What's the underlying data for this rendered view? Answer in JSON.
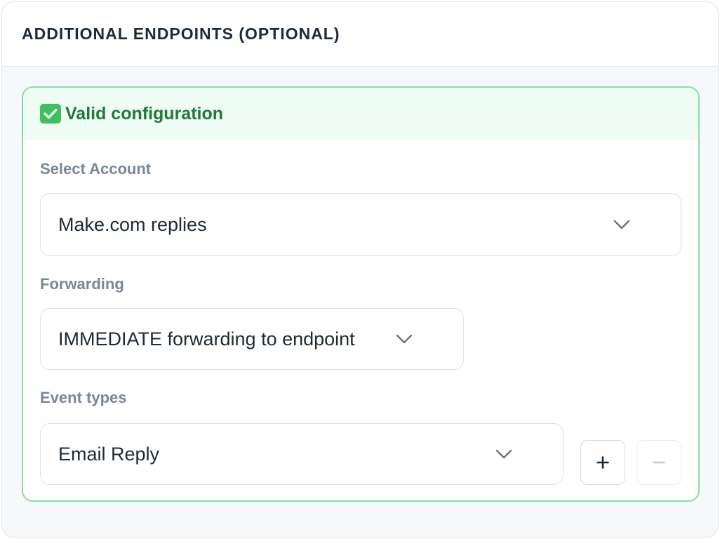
{
  "section": {
    "title": "ADDITIONAL ENDPOINTS (OPTIONAL)"
  },
  "endpoint": {
    "status": {
      "text": "Valid configuration",
      "icon": "check-icon",
      "color": "#1f7a3a"
    },
    "account": {
      "label": "Select Account",
      "value": "Make.com replies"
    },
    "forwarding": {
      "label": "Forwarding",
      "value": "IMMEDIATE forwarding to endpoint"
    },
    "event_types": {
      "label": "Event types",
      "value": "Email Reply"
    },
    "actions": {
      "add_label": "+",
      "remove_label": "−"
    }
  },
  "colors": {
    "success_border": "#86e0a6",
    "success_bg": "#effcf3",
    "label": "#7b8794",
    "text": "#1f2a37"
  }
}
